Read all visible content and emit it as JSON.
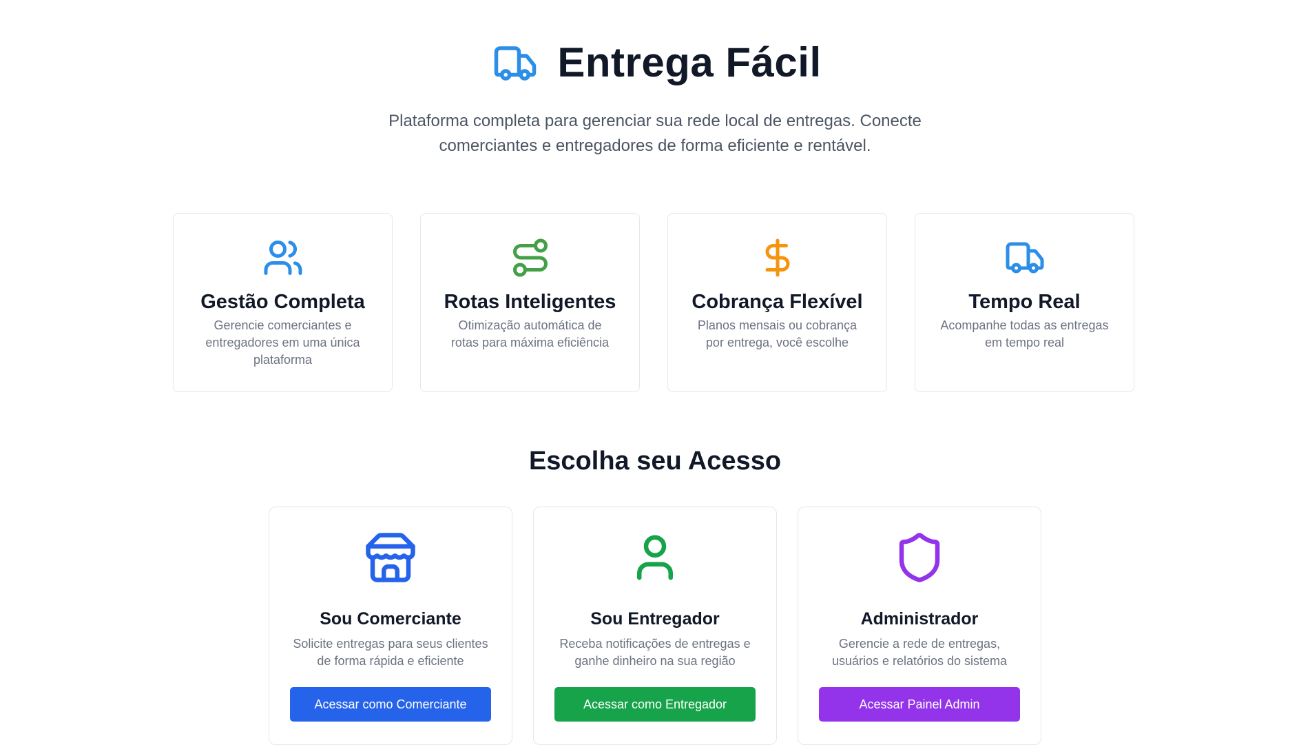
{
  "header": {
    "title": "Entrega Fácil",
    "logo_icon": "truck-icon",
    "subtitle": "Plataforma completa para gerenciar sua rede local de entregas. Conecte comerciantes e entregadores de forma eficiente e rentável."
  },
  "features": [
    {
      "icon": "users-icon",
      "color": "#2b8ee8",
      "title": "Gestão Completa",
      "description": "Gerencie comerciantes e entregadores em uma única plataforma"
    },
    {
      "icon": "route-icon",
      "color": "#43a047",
      "title": "Rotas Inteligentes",
      "description": "Otimização automática de rotas para máxima eficiência"
    },
    {
      "icon": "dollar-icon",
      "color": "#f5950f",
      "title": "Cobrança Flexível",
      "description": "Planos mensais ou cobrança por entrega, você escolhe"
    },
    {
      "icon": "truck-icon",
      "color": "#2b8ee8",
      "title": "Tempo Real",
      "description": "Acompanhe todas as entregas em tempo real"
    }
  ],
  "access_section": {
    "title": "Escolha seu Acesso"
  },
  "access_cards": [
    {
      "icon": "store-icon",
      "color": "#2563eb",
      "title": "Sou Comerciante",
      "description": "Solicite entregas para seus clientes de forma rápida e eficiente",
      "button_label": "Acessar como Comerciante"
    },
    {
      "icon": "user-icon",
      "color": "#16a34a",
      "title": "Sou Entregador",
      "description": "Receba notificações de entregas e ganhe dinheiro na sua região",
      "button_label": "Acessar como Entregador"
    },
    {
      "icon": "shield-icon",
      "color": "#9333ea",
      "title": "Administrador",
      "description": "Gerencie a rede de entregas, usuários e relatórios do sistema",
      "button_label": "Acessar Painel Admin"
    }
  ]
}
